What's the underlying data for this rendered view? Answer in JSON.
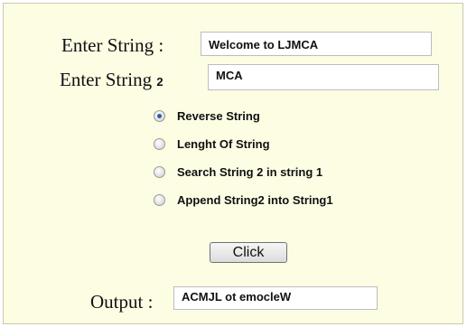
{
  "form": {
    "string1_label": "Enter String :",
    "string1_value": "Welcome to LJMCA",
    "string2_label": "Enter String",
    "string2_label_num": "2",
    "string2_value": "MCA",
    "options": [
      {
        "label": "Reverse String",
        "selected": true
      },
      {
        "label": "Lenght Of String",
        "selected": false
      },
      {
        "label": "Search String 2 in string 1",
        "selected": false
      },
      {
        "label": "Append String2 into String1",
        "selected": false
      }
    ],
    "button_label": "Click",
    "output_label": "Output :",
    "output_value": "ACMJL ot emocleW"
  },
  "colors": {
    "panel_background": "#fdfde4",
    "radio_selected": "#2b5fa8"
  }
}
